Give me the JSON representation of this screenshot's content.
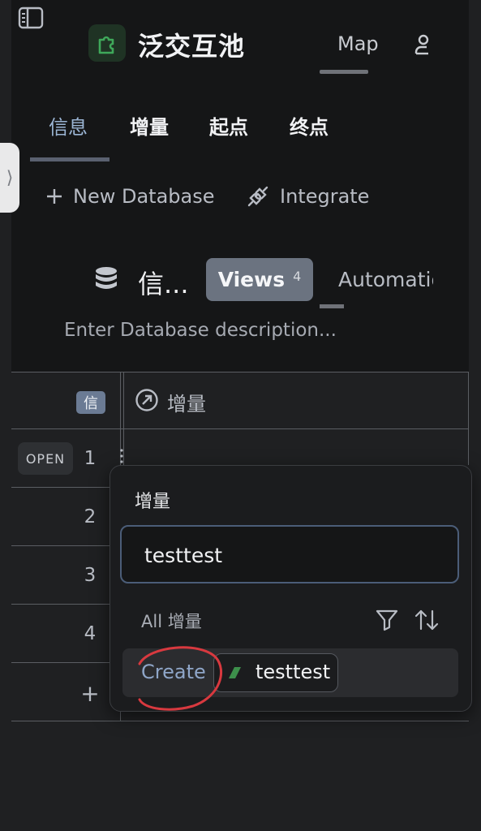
{
  "header": {
    "workspace_title": "泛交互池",
    "map_label": "Map"
  },
  "tabs": [
    {
      "label": "信息",
      "active": true
    },
    {
      "label": "增量",
      "active": false
    },
    {
      "label": "起点",
      "active": false
    },
    {
      "label": "终点",
      "active": false
    }
  ],
  "actions": {
    "new_database": "New Database",
    "integrate": "Integrate"
  },
  "database": {
    "name": "信...",
    "views_label": "Views",
    "views_count": "4",
    "automations_label": "Automations",
    "description_placeholder": "Enter Database description..."
  },
  "table": {
    "primary_badge": "信",
    "column_label": "增量",
    "open_label": "OPEN",
    "row_numbers": [
      "1",
      "2",
      "3",
      "4"
    ],
    "add_row": "+"
  },
  "popover": {
    "title": "增量",
    "input_value": "testtest",
    "all_label": "All 增量",
    "create_label": "Create",
    "chip_label": "testtest"
  },
  "colors": {
    "accent": "#9bb5d4",
    "chip_flag": "#3d8f4b",
    "annotation": "#d8393f"
  }
}
